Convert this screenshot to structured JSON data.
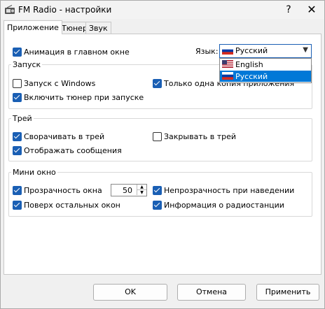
{
  "window": {
    "title": "FM Radio - настройки",
    "help": "?",
    "close": "✕"
  },
  "tabs": [
    {
      "label": "Приложение",
      "active": true
    },
    {
      "label": "Тюнер",
      "active": false
    },
    {
      "label": "Звук",
      "active": false
    }
  ],
  "app": {
    "animation": {
      "label": "Анимация в главном окне",
      "checked": true
    },
    "language_label": "Язык:",
    "language_selected": "Русский",
    "language_options": [
      {
        "label": "English",
        "flag": "us"
      },
      {
        "label": "Русский",
        "flag": "ru",
        "selected": true
      }
    ]
  },
  "startup": {
    "title": "Запуск",
    "with_windows": {
      "label": "Запуск с Windows",
      "checked": false
    },
    "single_instance": {
      "label": "Только одна копия приложения",
      "checked": true
    },
    "tuner_on_start": {
      "label": "Включить тюнер при запуске",
      "checked": true
    }
  },
  "tray": {
    "title": "Трей",
    "minimize": {
      "label": "Сворачивать в трей",
      "checked": true
    },
    "close": {
      "label": "Закрывать в трей",
      "checked": false
    },
    "messages": {
      "label": "Отображать сообщения",
      "checked": true
    }
  },
  "mini": {
    "title": "Мини окно",
    "transparency": {
      "label": "Прозрачность окна",
      "checked": true,
      "value": "50"
    },
    "opaque_hover": {
      "label": "Непрозрачность при наведении",
      "checked": true
    },
    "on_top": {
      "label": "Поверх остальных окон",
      "checked": true
    },
    "station_info": {
      "label": "Информация о радиостанции",
      "checked": true
    }
  },
  "buttons": {
    "ok": "OK",
    "cancel": "Отмена",
    "apply": "Применить"
  },
  "colors": {
    "accent": "#1a5fb4",
    "selection": "#0078d7"
  }
}
